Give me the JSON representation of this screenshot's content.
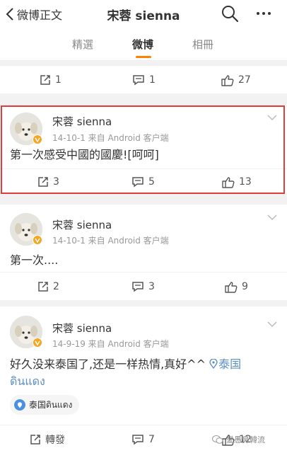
{
  "nav": {
    "back_label": "微博正文",
    "title": "宋蓉 sienna"
  },
  "tabs": [
    {
      "label": "精選"
    },
    {
      "label": "微博"
    },
    {
      "label": "相冊"
    }
  ],
  "top_actions": {
    "repost": "1",
    "comment": "1",
    "like": "27"
  },
  "posts": [
    {
      "username": "宋蓉 sienna",
      "meta": "14-10-1  来自 Android 客户端",
      "text": "第一次感受中國的國慶![呵呵]",
      "repost": "3",
      "comment": "5",
      "like": "13",
      "highlighted": true
    },
    {
      "username": "宋蓉 sienna",
      "meta": "14-10-1  来自 Android 客户端",
      "text": "第一次....",
      "repost": "2",
      "comment": "3",
      "like": "9"
    },
    {
      "username": "宋蓉 sienna",
      "meta": "14-9-19  来自 Android 客户端",
      "text": "好久没来泰国了,还是一样热情,真好^^ ",
      "location_link": "泰国",
      "text_line2": "ดินแดง",
      "location_chip": "泰国ดินแดง",
      "repost": "轉發",
      "comment": "7",
      "like": "12"
    }
  ],
  "watermark": "愛愚鼻韓流",
  "colors": {
    "accent": "#ff8200",
    "highlight_border": "#e23b3b",
    "link": "#5d8fc6",
    "verified_badge": "#f5a623"
  }
}
